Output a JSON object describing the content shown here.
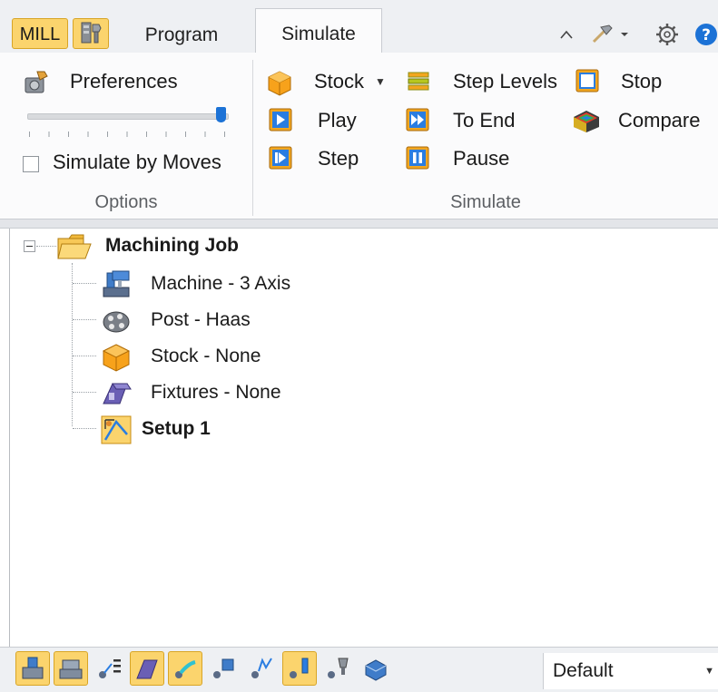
{
  "window": {
    "mode_button": "MILL"
  },
  "tabs": [
    {
      "label": "Program"
    },
    {
      "label": "Simulate",
      "active": true
    }
  ],
  "ribbon": {
    "options": {
      "preferences_label": "Preferences",
      "simulate_by_moves_label": "Simulate by Moves",
      "simulate_by_moves_checked": false,
      "speed_slider_value": 1.0,
      "group_label": "Options"
    },
    "simulate": {
      "stock_label": "Stock",
      "play_label": "Play",
      "step_label": "Step",
      "step_levels_label": "Step Levels",
      "to_end_label": "To End",
      "pause_label": "Pause",
      "stop_label": "Stop",
      "compare_label": "Compare",
      "group_label": "Simulate"
    }
  },
  "tree": {
    "root": "Machining Job",
    "children": [
      {
        "label": "Machine - 3 Axis",
        "icon": "machine-icon"
      },
      {
        "label": "Post - Haas",
        "icon": "post-icon"
      },
      {
        "label": "Stock - None",
        "icon": "stock-box-icon"
      },
      {
        "label": "Fixtures - None",
        "icon": "fixtures-icon"
      },
      {
        "label": "Setup 1",
        "icon": "setup-icon",
        "bold": true
      }
    ]
  },
  "bottom_toolbar": {
    "view_select_value": "Default",
    "buttons": [
      {
        "icon": "show-machine-icon",
        "on": true
      },
      {
        "icon": "show-machine-table-icon",
        "on": true
      },
      {
        "icon": "show-toolpath-list-icon",
        "on": false
      },
      {
        "icon": "show-fixtures-icon",
        "on": true
      },
      {
        "icon": "show-part-icon",
        "on": true
      },
      {
        "icon": "show-stock-icon",
        "on": false
      },
      {
        "icon": "show-toolpath-icon",
        "on": false
      },
      {
        "icon": "show-tool-icon",
        "on": true
      },
      {
        "icon": "show-holder-icon",
        "on": false
      },
      {
        "icon": "show-workpiece-icon",
        "on": false
      }
    ]
  },
  "colors": {
    "accent_yellow": "#fbd46d",
    "accent_blue": "#1c72d6",
    "ribbon_bg": "#fbfbfc",
    "tabstrip_bg": "#eef0f3"
  }
}
